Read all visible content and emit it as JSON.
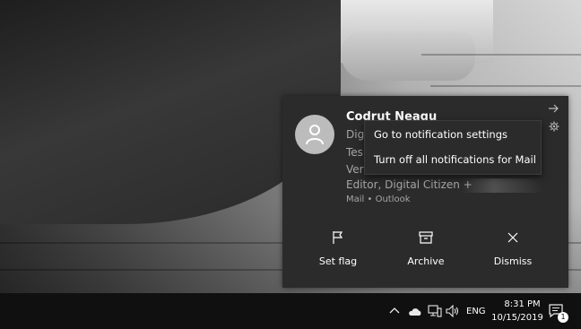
{
  "notification": {
    "sender": "Codrut Neagu",
    "body_lines": [
      "Dig",
      "Tes",
      "Ver",
      "Editor, Digital Citizen +"
    ],
    "attribution": "Mail • Outlook",
    "actions": [
      {
        "label": "Set flag",
        "icon": "flag-icon"
      },
      {
        "label": "Archive",
        "icon": "archive-icon"
      },
      {
        "label": "Dismiss",
        "icon": "close-icon"
      }
    ]
  },
  "context_menu": {
    "items": [
      "Go to notification settings",
      "Turn off all notifications for Mail"
    ]
  },
  "taskbar": {
    "language": "ENG",
    "time": "8:31 PM",
    "date": "10/15/2019",
    "action_center_badge": "1"
  },
  "colors": {
    "toast_bg": "#2b2b2b",
    "taskbar_bg": "#101010",
    "secondary_text": "#a6a6a6"
  }
}
